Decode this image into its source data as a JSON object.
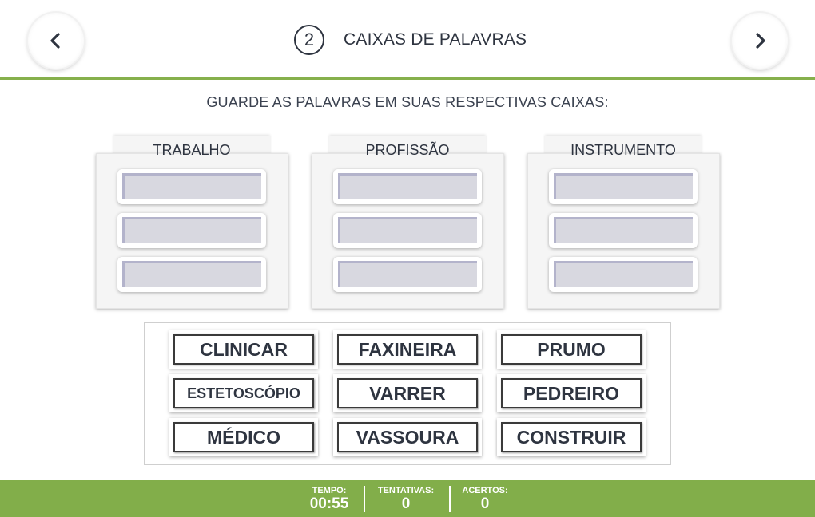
{
  "header": {
    "step_number": "2",
    "title": "CAIXAS DE PALAVRAS",
    "prev_icon": "chevron-left-icon",
    "next_icon": "chevron-right-icon"
  },
  "instruction": "GUARDE AS PALAVRAS EM SUAS RESPECTIVAS CAIXAS:",
  "boxes": [
    {
      "label": "TRABALHO",
      "slots": 3
    },
    {
      "label": "PROFISSÃO",
      "slots": 3
    },
    {
      "label": "INSTRUMENTO",
      "slots": 3
    }
  ],
  "words": [
    "CLINICAR",
    "FAXINEIRA",
    "PRUMO",
    "ESTETOSCÓPIO",
    "VARRER",
    "PEDREIRO",
    "MÉDICO",
    "VASSOURA",
    "CONSTRUIR"
  ],
  "footer": {
    "time_label": "TEMPO:",
    "time_value": "00:55",
    "attempts_label": "TENTATIVAS:",
    "attempts_value": "0",
    "hits_label": "ACERTOS:",
    "hits_value": "0"
  },
  "colors": {
    "accent_green": "#82ae4a",
    "text_dark": "#2e3440",
    "slot_fill": "#d8d8e0"
  }
}
